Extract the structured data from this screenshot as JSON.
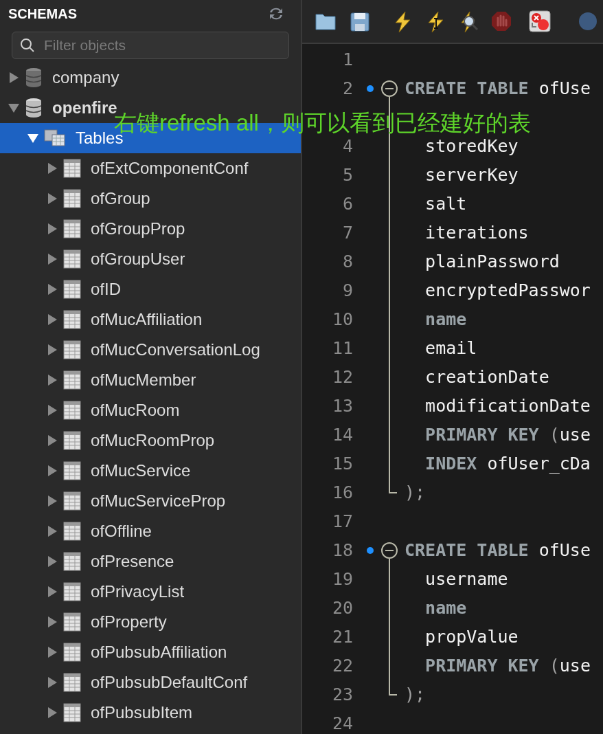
{
  "sidebar": {
    "title": "SCHEMAS",
    "search": {
      "placeholder": "Filter objects"
    },
    "tree": [
      {
        "label": "company",
        "kind": "schema",
        "expanded": false,
        "selected": false
      },
      {
        "label": "openfire",
        "kind": "schema",
        "expanded": true,
        "selected": false,
        "children": [
          {
            "label": "Tables",
            "kind": "folder",
            "expanded": true,
            "selected": true,
            "children": [
              {
                "label": "ofExtComponentConf",
                "kind": "table",
                "expanded": false,
                "selected": false
              },
              {
                "label": "ofGroup",
                "kind": "table",
                "expanded": false,
                "selected": false
              },
              {
                "label": "ofGroupProp",
                "kind": "table",
                "expanded": false,
                "selected": false
              },
              {
                "label": "ofGroupUser",
                "kind": "table",
                "expanded": false,
                "selected": false
              },
              {
                "label": "ofID",
                "kind": "table",
                "expanded": false,
                "selected": false
              },
              {
                "label": "ofMucAffiliation",
                "kind": "table",
                "expanded": false,
                "selected": false
              },
              {
                "label": "ofMucConversationLog",
                "kind": "table",
                "expanded": false,
                "selected": false
              },
              {
                "label": "ofMucMember",
                "kind": "table",
                "expanded": false,
                "selected": false
              },
              {
                "label": "ofMucRoom",
                "kind": "table",
                "expanded": false,
                "selected": false
              },
              {
                "label": "ofMucRoomProp",
                "kind": "table",
                "expanded": false,
                "selected": false
              },
              {
                "label": "ofMucService",
                "kind": "table",
                "expanded": false,
                "selected": false
              },
              {
                "label": "ofMucServiceProp",
                "kind": "table",
                "expanded": false,
                "selected": false
              },
              {
                "label": "ofOffline",
                "kind": "table",
                "expanded": false,
                "selected": false
              },
              {
                "label": "ofPresence",
                "kind": "table",
                "expanded": false,
                "selected": false
              },
              {
                "label": "ofPrivacyList",
                "kind": "table",
                "expanded": false,
                "selected": false
              },
              {
                "label": "ofProperty",
                "kind": "table",
                "expanded": false,
                "selected": false
              },
              {
                "label": "ofPubsubAffiliation",
                "kind": "table",
                "expanded": false,
                "selected": false
              },
              {
                "label": "ofPubsubDefaultConf",
                "kind": "table",
                "expanded": false,
                "selected": false
              },
              {
                "label": "ofPubsubItem",
                "kind": "table",
                "expanded": false,
                "selected": false
              }
            ]
          }
        ]
      }
    ]
  },
  "toolbar": [
    {
      "kind": "folder"
    },
    {
      "kind": "save"
    },
    {
      "kind": "execute"
    },
    {
      "kind": "execute-current"
    },
    {
      "kind": "explain"
    },
    {
      "kind": "stop"
    },
    {
      "kind": "stop-on-error"
    },
    {
      "kind": "partial"
    }
  ],
  "editor": {
    "lines": [
      {
        "number": "1",
        "bookmark": false
      },
      {
        "number": "2",
        "bookmark": true,
        "fold_start": true,
        "segments": [
          {
            "kind": "keyword",
            "text": "CREATE TABLE"
          },
          {
            "kind": "plain",
            "text": " ofUse"
          }
        ]
      },
      {
        "bookmark": false
      },
      {
        "number": "4",
        "bookmark": false,
        "segments": [
          {
            "kind": "plain",
            "text": "  storedKey"
          }
        ]
      },
      {
        "number": "5",
        "bookmark": false,
        "segments": [
          {
            "kind": "plain",
            "text": "  serverKey"
          }
        ]
      },
      {
        "number": "6",
        "bookmark": false,
        "segments": [
          {
            "kind": "plain",
            "text": "  salt"
          }
        ]
      },
      {
        "number": "7",
        "bookmark": false,
        "segments": [
          {
            "kind": "plain",
            "text": "  iterations"
          }
        ]
      },
      {
        "number": "8",
        "bookmark": false,
        "segments": [
          {
            "kind": "plain",
            "text": "  plainPassword"
          }
        ]
      },
      {
        "number": "9",
        "bookmark": false,
        "segments": [
          {
            "kind": "plain",
            "text": "  encryptedPasswor"
          }
        ]
      },
      {
        "number": "10",
        "bookmark": false,
        "segments": [
          {
            "kind": "keyword",
            "text": "  name"
          }
        ]
      },
      {
        "number": "11",
        "bookmark": false,
        "segments": [
          {
            "kind": "plain",
            "text": "  email"
          }
        ]
      },
      {
        "number": "12",
        "bookmark": false,
        "segments": [
          {
            "kind": "plain",
            "text": "  creationDate"
          }
        ]
      },
      {
        "number": "13",
        "bookmark": false,
        "segments": [
          {
            "kind": "plain",
            "text": "  modificationDate"
          }
        ]
      },
      {
        "number": "14",
        "bookmark": false,
        "segments": [
          {
            "kind": "keyword",
            "text": "  PRIMARY KEY"
          },
          {
            "kind": "punct",
            "text": " ("
          },
          {
            "kind": "plain",
            "text": "use"
          }
        ]
      },
      {
        "number": "15",
        "bookmark": false,
        "segments": [
          {
            "kind": "keyword",
            "text": "  INDEX"
          },
          {
            "kind": "plain",
            "text": " ofUser_cDa"
          }
        ]
      },
      {
        "number": "16",
        "bookmark": false,
        "fold_end": true,
        "segments": [
          {
            "kind": "punct",
            "text": ");"
          }
        ]
      },
      {
        "number": "17",
        "bookmark": false
      },
      {
        "number": "18",
        "bookmark": true,
        "fold_start": true,
        "segments": [
          {
            "kind": "keyword",
            "text": "CREATE TABLE"
          },
          {
            "kind": "plain",
            "text": " ofUse"
          }
        ]
      },
      {
        "number": "19",
        "bookmark": false,
        "segments": [
          {
            "kind": "plain",
            "text": "  username"
          }
        ]
      },
      {
        "number": "20",
        "bookmark": false,
        "segments": [
          {
            "kind": "keyword",
            "text": "  name"
          }
        ]
      },
      {
        "number": "21",
        "bookmark": false,
        "segments": [
          {
            "kind": "plain",
            "text": "  propValue"
          }
        ]
      },
      {
        "number": "22",
        "bookmark": false,
        "segments": [
          {
            "kind": "keyword",
            "text": "  PRIMARY KEY"
          },
          {
            "kind": "punct",
            "text": " ("
          },
          {
            "kind": "plain",
            "text": "use"
          }
        ]
      },
      {
        "number": "23",
        "bookmark": false,
        "fold_end": true,
        "segments": [
          {
            "kind": "punct",
            "text": ");"
          }
        ]
      },
      {
        "number": "24",
        "bookmark": false
      }
    ]
  },
  "annotation": {
    "text": "右键refresh all，则可以看到已经建好的表"
  }
}
